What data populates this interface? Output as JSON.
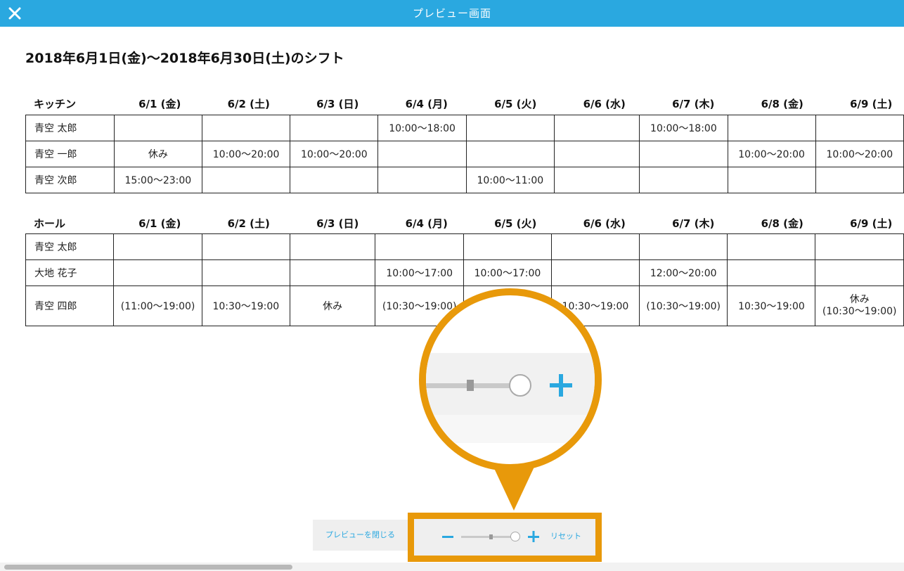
{
  "header": {
    "title": "プレビュー画面",
    "close_icon": "close-icon"
  },
  "heading": "2018年6月1日(金)〜2018年6月30日(土)のシフト",
  "days": [
    "6/1 (金)",
    "6/2 (土)",
    "6/3 (日)",
    "6/4 (月)",
    "6/5 (火)",
    "6/6 (水)",
    "6/7 (木)",
    "6/8 (金)",
    "6/9 (土)"
  ],
  "kitchen": {
    "label": "キッチン",
    "rows": [
      {
        "name": "青空 太郎",
        "cells": [
          "",
          "",
          "",
          "10:00〜18:00",
          "",
          "",
          "10:00〜18:00",
          "",
          ""
        ]
      },
      {
        "name": "青空 一郎",
        "cells": [
          "休み",
          "10:00〜20:00",
          "10:00〜20:00",
          "",
          "",
          "",
          "",
          "10:00〜20:00",
          "10:00〜20:00"
        ]
      },
      {
        "name": "青空 次郎",
        "cells": [
          "15:00〜23:00",
          "",
          "",
          "",
          "10:00〜11:00",
          "",
          "",
          "",
          ""
        ]
      }
    ]
  },
  "hall": {
    "label": "ホール",
    "rows": [
      {
        "name": "青空 太郎",
        "cells": [
          "",
          "",
          "",
          "",
          "",
          "",
          "",
          "",
          ""
        ]
      },
      {
        "name": "大地 花子",
        "cells": [
          "",
          "",
          "",
          "10:00〜17:00",
          "10:00〜17:00",
          "",
          "12:00〜20:00",
          "",
          ""
        ]
      },
      {
        "name": "青空 四郎",
        "cells": [
          "(11:00〜19:00)",
          "10:30〜19:00",
          "休み",
          "(10:30〜19:00)",
          "",
          "10:30〜19:00",
          "(10:30〜19:00)",
          "10:30〜19:00",
          "休み\n(10:30〜19:00)"
        ]
      }
    ]
  },
  "footer": {
    "close_preview": "プレビューを閉じる",
    "reset": "リセット",
    "zoom_level": 0.9
  },
  "colors": {
    "accent": "#2aa8e0",
    "highlight": "#e8990a"
  }
}
